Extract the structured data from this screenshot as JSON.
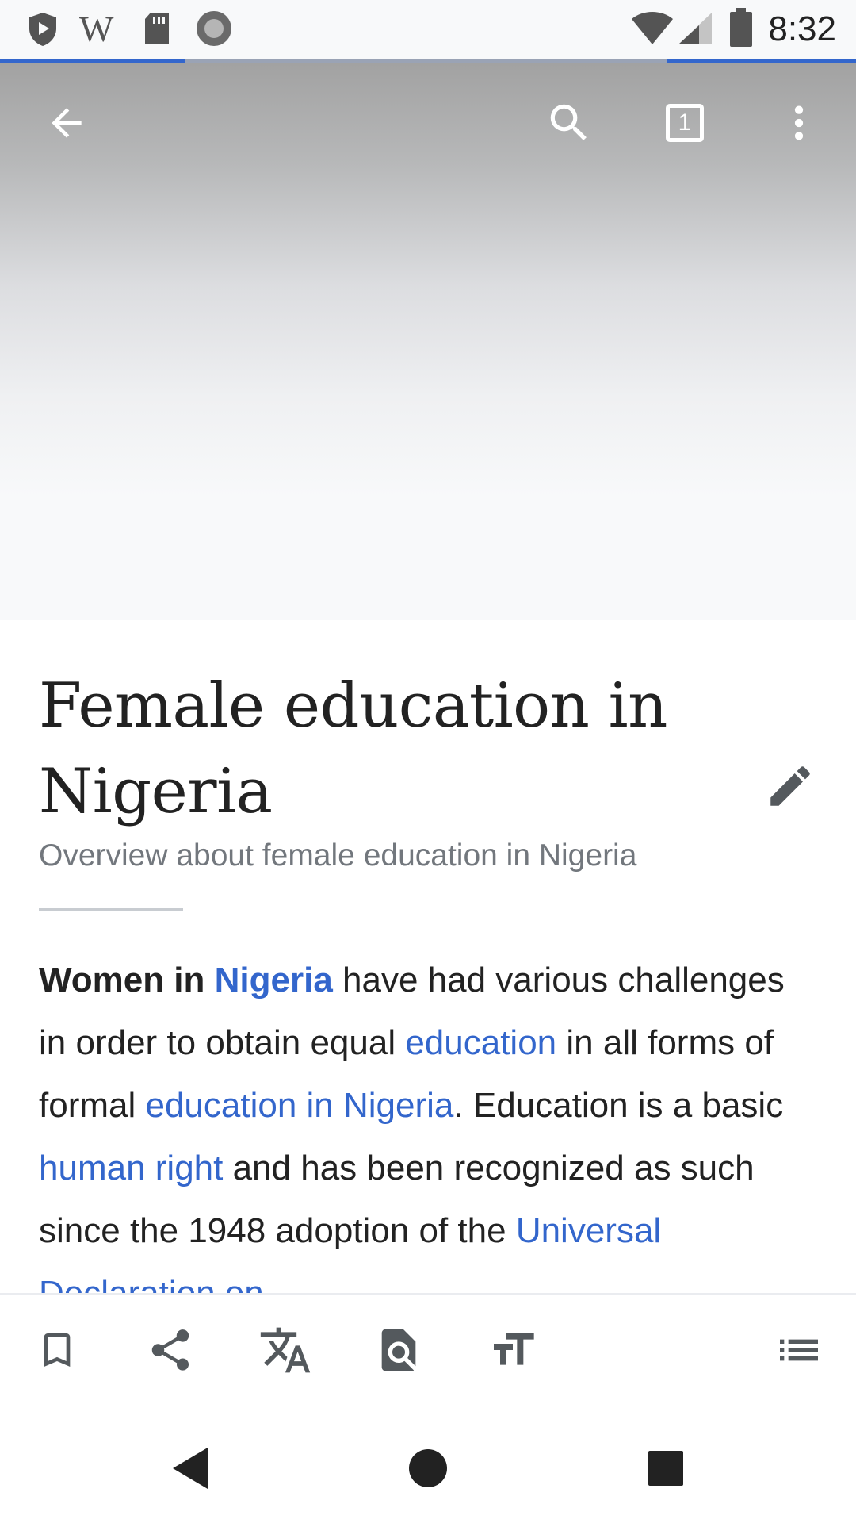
{
  "status_bar": {
    "time": "8:32",
    "left_icons": [
      "play-protect-icon",
      "wikipedia-w-icon",
      "sd-card-icon",
      "circle-record-icon"
    ],
    "right_icons": [
      "wifi-icon",
      "cellular-signal-icon",
      "battery-icon"
    ],
    "wiki_letter": "W"
  },
  "toolbar": {
    "back_icon": "arrow-back-icon",
    "search_icon": "search-icon",
    "tabs_count": "1",
    "overflow_icon": "more-vert-icon"
  },
  "progress": {
    "segments": [
      {
        "start_fraction": 0.0,
        "end_fraction": 0.216
      },
      {
        "start_fraction": 0.78,
        "end_fraction": 1.0
      }
    ]
  },
  "article": {
    "title": "Female education in Nigeria",
    "description": "Overview about female education in Nigeria",
    "lead_runs": [
      {
        "text": "Women in ",
        "style": "bold"
      },
      {
        "text": "Nigeria",
        "style": "link-bold"
      },
      {
        "text": " have had various challenges in order to obtain equal ",
        "style": "plain"
      },
      {
        "text": "education",
        "style": "link"
      },
      {
        "text": " in all forms of formal ",
        "style": "plain"
      },
      {
        "text": "education in Nigeria",
        "style": "link"
      },
      {
        "text": ". Education is a basic ",
        "style": "plain"
      },
      {
        "text": "human right",
        "style": "link"
      },
      {
        "text": " and has been recognized as such since the 1948 adoption of the ",
        "style": "plain"
      },
      {
        "text": "Universal Declaration on",
        "style": "link"
      }
    ]
  },
  "page_actions": {
    "items": [
      "bookmark-icon",
      "share-icon",
      "translate-icon",
      "find-in-page-icon",
      "text-size-icon",
      "contents-list-icon"
    ]
  },
  "nav_bar": {
    "items": [
      "nav-back-icon",
      "nav-home-icon",
      "nav-recents-icon"
    ]
  },
  "colors": {
    "link": "#3366cc",
    "text": "#222222",
    "description": "#72777d",
    "icon_dark": "#54595d",
    "progress": "#3366cc"
  }
}
